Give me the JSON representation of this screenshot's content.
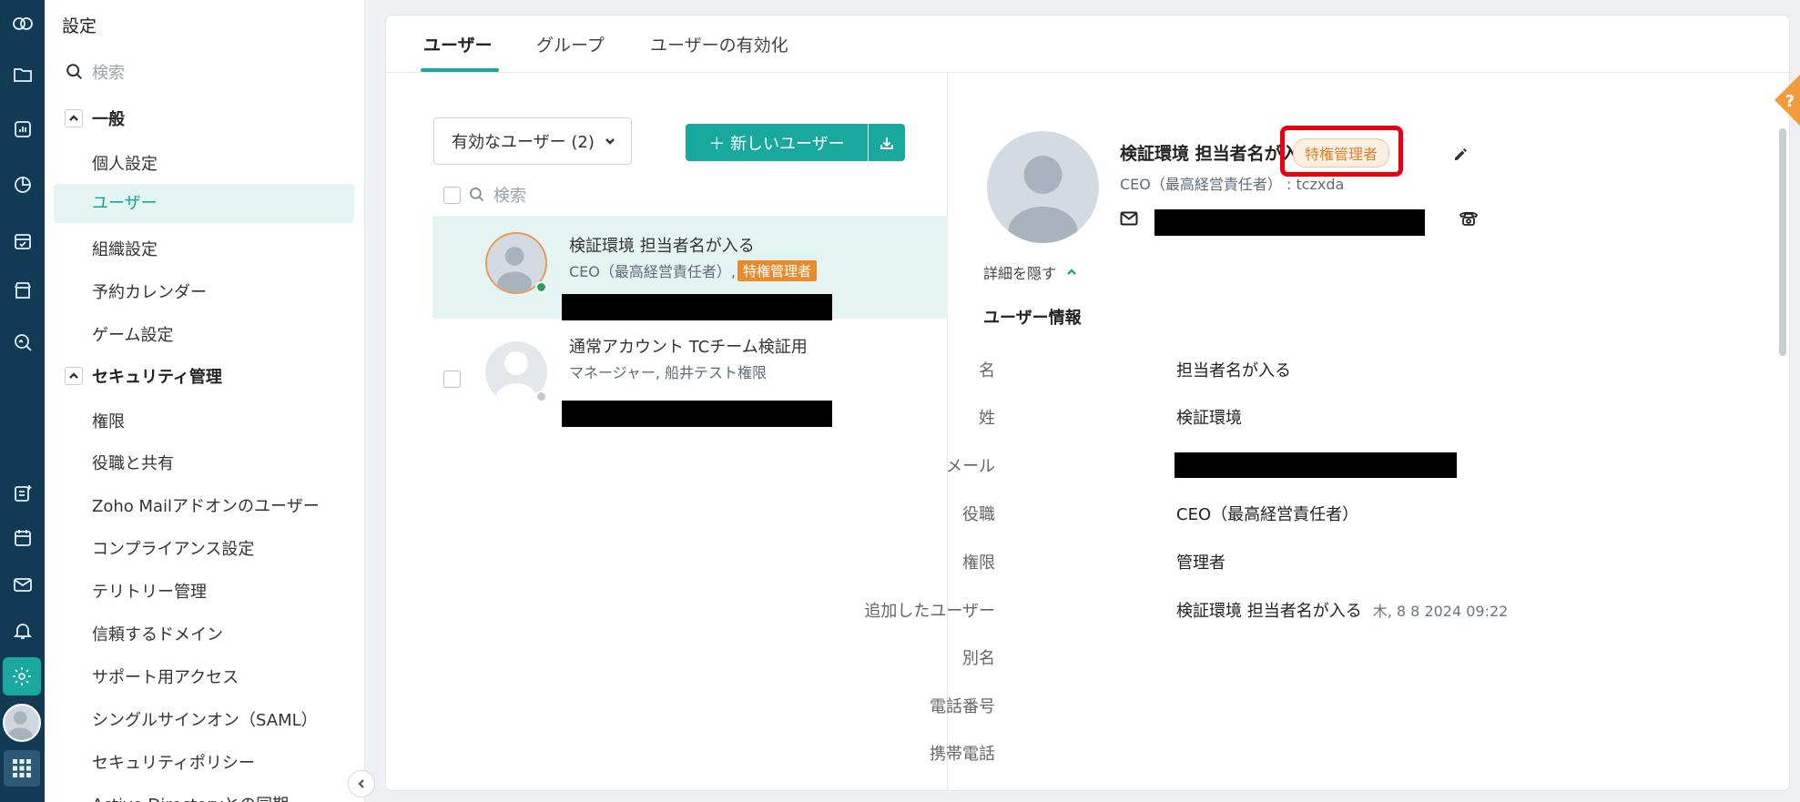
{
  "colors": {
    "rail_bg": "#113b55",
    "accent": "#19a89d",
    "badge_orange": "#e88a2e",
    "highlight_red": "#e8000f"
  },
  "rail": {
    "icons": [
      "zoho-cloud-logo-icon",
      "folder-icon",
      "report-icon",
      "analytics-icon",
      "calendar-check-icon",
      "store-icon",
      "search-data-icon",
      "add-note-icon",
      "calendar-icon",
      "mail-icon",
      "bell-icon",
      "settings-icon",
      "user-avatar",
      "apps-grid-icon"
    ]
  },
  "sidebar": {
    "title": "設定",
    "search_placeholder": "検索",
    "sections": [
      {
        "label": "一般",
        "items": [
          "個人設定",
          "ユーザー",
          "組織設定",
          "予約カレンダー",
          "ゲーム設定"
        ]
      },
      {
        "label": "セキュリティ管理",
        "items": [
          "権限",
          "役職と共有",
          "Zoho Mailアドオンのユーザー",
          "コンプライアンス設定",
          "テリトリー管理",
          "信頼するドメイン",
          "サポート用アクセス",
          "シングルサインオン（SAML）",
          "セキュリティポリシー",
          "Active Directoryとの同期"
        ]
      }
    ],
    "active_item": "ユーザー"
  },
  "tabs": [
    "ユーザー",
    "グループ",
    "ユーザーの有効化"
  ],
  "list": {
    "filter_label": "有効なユーザー (2)",
    "new_user_label": "＋ 新しいユーザー",
    "search_placeholder": "検索",
    "users": [
      {
        "name": "検証環境 担当者名が入る",
        "role": "CEO（最高経営責任者）,",
        "badge": "特権管理者",
        "status": "online"
      },
      {
        "name": "通常アカウント TCチーム検証用",
        "role": "マネージャー, 船井テスト権限",
        "badge": "",
        "status": "offline"
      }
    ]
  },
  "detail": {
    "name": "検証環境 担当者名が入る",
    "badge": "特権管理者",
    "role_line": "CEO（最高経営責任者）   :   tczxda",
    "toggle_label": "詳細を隠す",
    "section_title": "ユーザー情報",
    "fields": [
      {
        "label": "名",
        "value": "担当者名が入る"
      },
      {
        "label": "姓",
        "value": "検証環境"
      },
      {
        "label": "メール",
        "value": ""
      },
      {
        "label": "役職",
        "value": "CEO（最高経営責任者）"
      },
      {
        "label": "権限",
        "value": "管理者"
      },
      {
        "label": "追加したユーザー",
        "value": "検証環境 担当者名が入る",
        "extra": "木, 8 8 2024 09:22"
      },
      {
        "label": "別名",
        "value": ""
      },
      {
        "label": "電話番号",
        "value": ""
      },
      {
        "label": "携帯電話",
        "value": ""
      }
    ]
  },
  "help_label": "?"
}
